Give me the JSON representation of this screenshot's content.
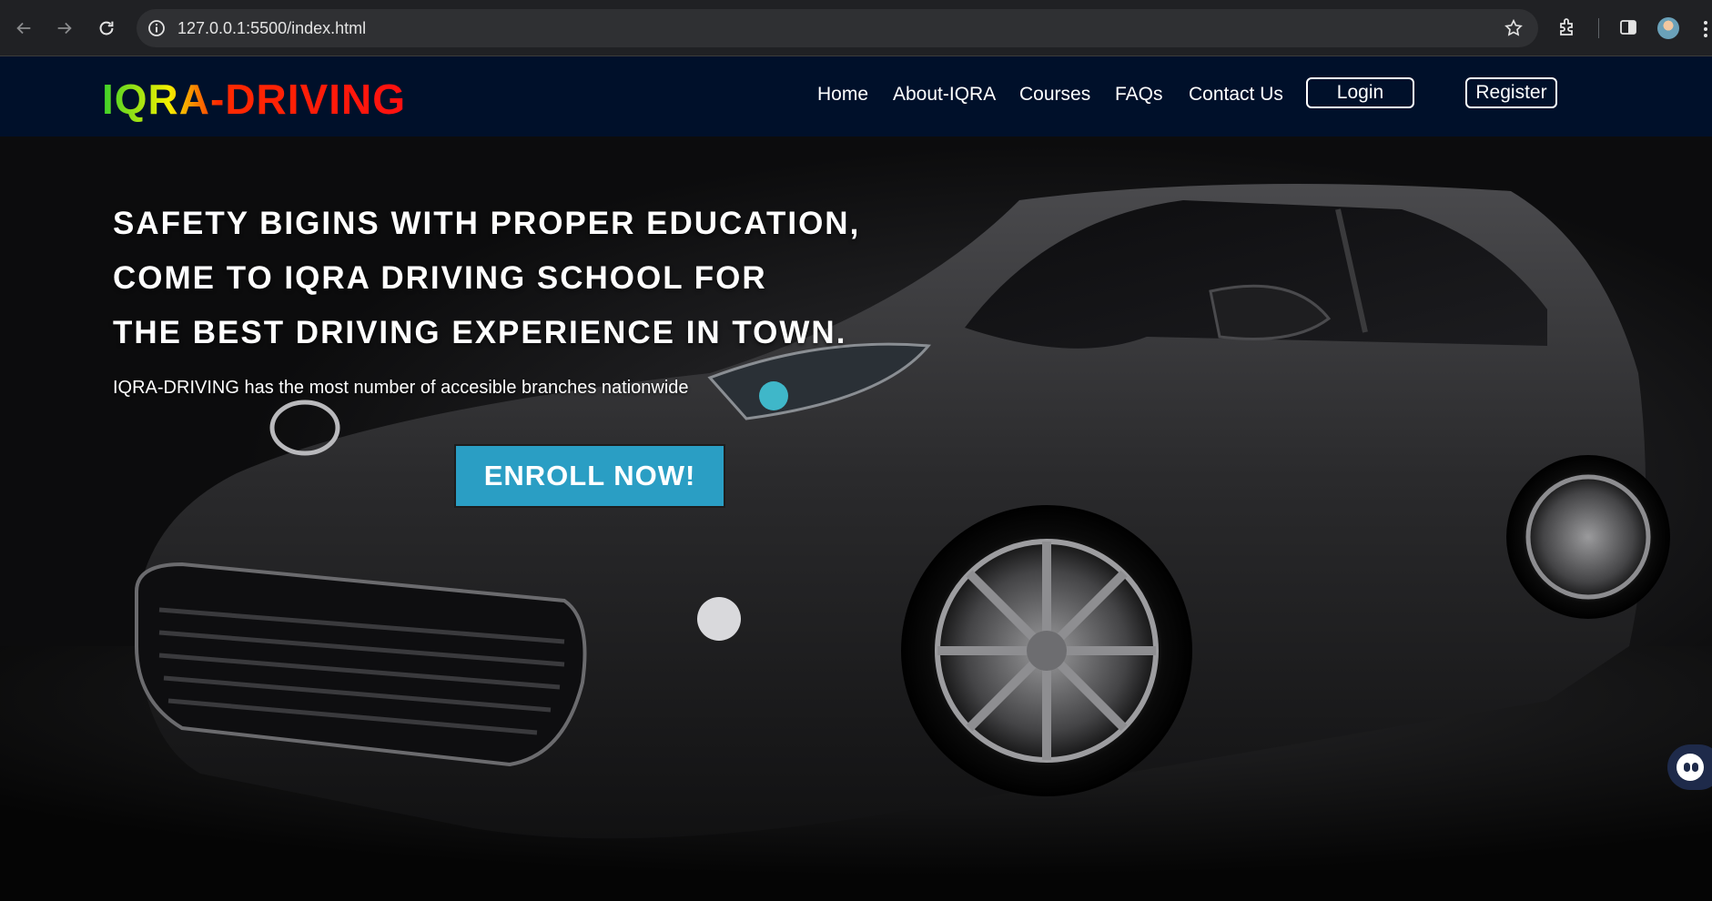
{
  "browser": {
    "url": "127.0.0.1:5500/index.html",
    "icons": [
      "back-icon",
      "forward-icon",
      "reload-icon",
      "site-info-icon",
      "bookmark-star-icon",
      "extensions-icon",
      "side-panel-icon",
      "profile-avatar",
      "menu-icon"
    ]
  },
  "site": {
    "logo": "IQRA-DRIVING",
    "nav": {
      "home": "Home",
      "about": "About-IQRA",
      "courses": "Courses",
      "faqs": "FAQs",
      "contact": "Contact Us",
      "login": "Login",
      "register": "Register"
    },
    "colors": {
      "header_bg": "#00102a",
      "enroll_bg": "#2a9ec4",
      "logo_gradient": [
        "#3bd12a",
        "#f5f000",
        "#ff2a00"
      ]
    }
  },
  "hero": {
    "headline": [
      "SAFETY BIGINS WITH PROPER EDUCATION,",
      "COME TO IQRA DRIVING SCHOOL FOR",
      "THE BEST DRIVING EXPERIENCE IN TOWN."
    ],
    "subtext": "IQRA-DRIVING has the most number of accesible branches nationwide",
    "cta": "ENROLL NOW!"
  }
}
